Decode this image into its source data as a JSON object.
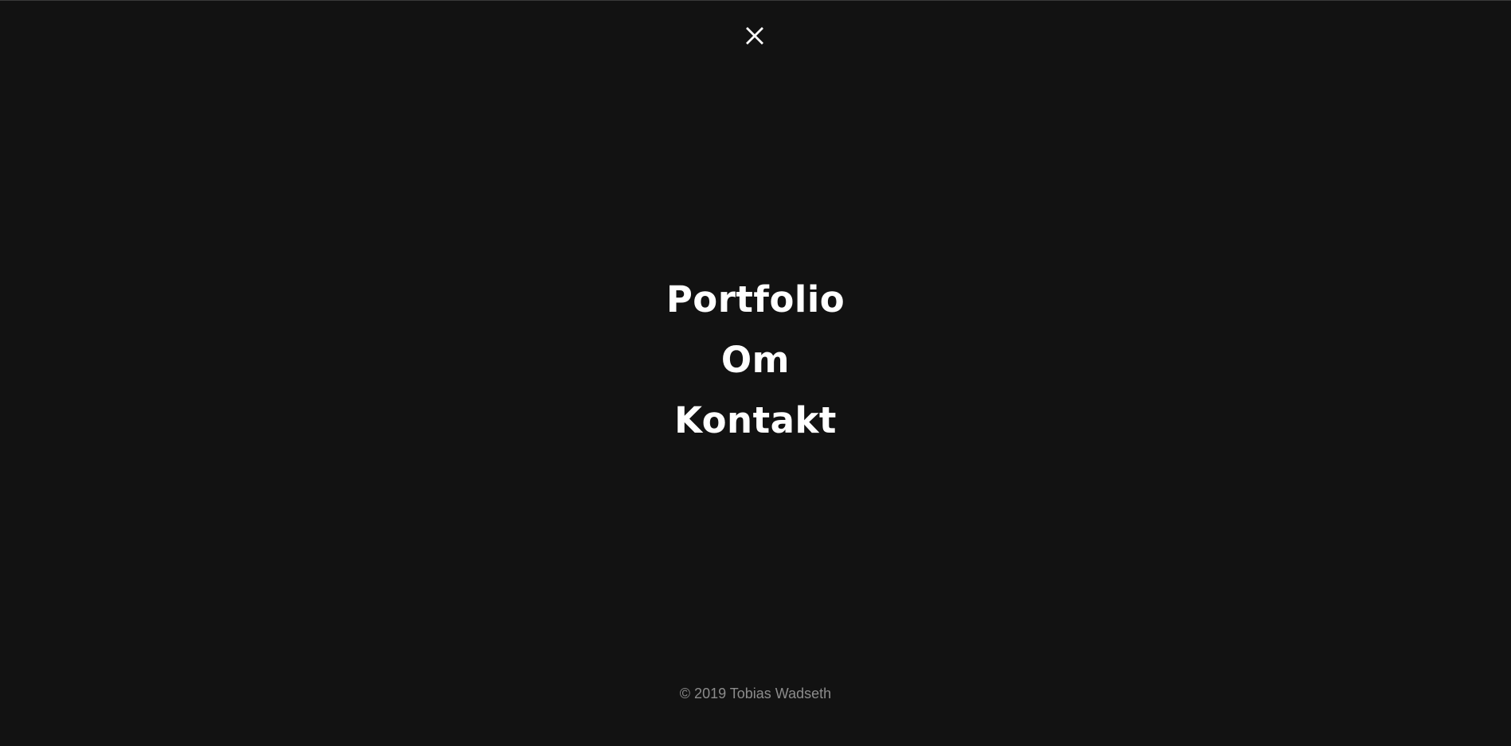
{
  "header": {
    "close_icon": "close-icon"
  },
  "menu": {
    "items": [
      {
        "label": "Portfolio"
      },
      {
        "label": "Om"
      },
      {
        "label": "Kontakt"
      }
    ]
  },
  "footer": {
    "copyright": "© 2019 Tobias Wadseth"
  },
  "colors": {
    "background": "#121212",
    "text": "#ffffff",
    "footer_text": "#8c8c8c"
  }
}
